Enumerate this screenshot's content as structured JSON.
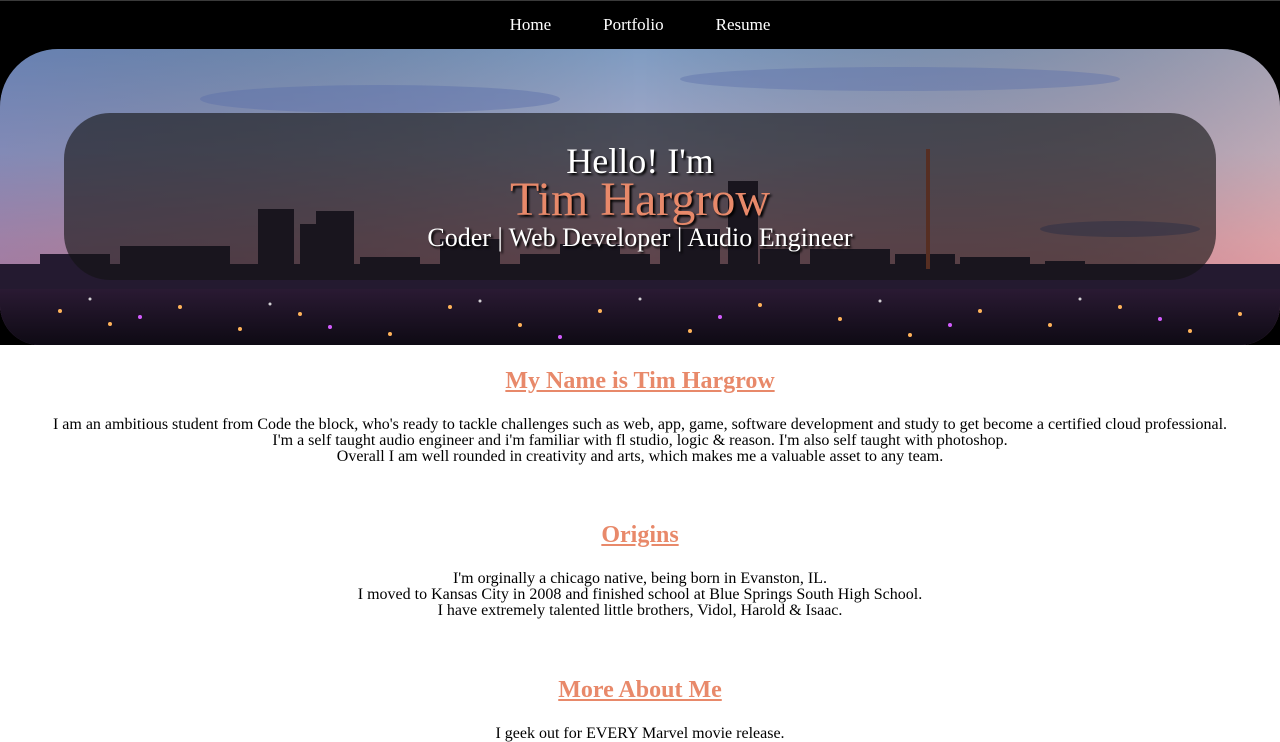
{
  "nav": {
    "items": [
      {
        "label": "Home"
      },
      {
        "label": "Portfolio"
      },
      {
        "label": "Resume"
      }
    ]
  },
  "hero": {
    "greeting": "Hello! I'm",
    "name": "Tim Hargrow",
    "tagline": "Coder | Web Developer | Audio Engineer",
    "image": "city-skyline-at-dusk"
  },
  "sections": [
    {
      "heading": "My Name is Tim Hargrow",
      "lines": [
        "I am an ambitious student from Code the block, who's ready to tackle challenges such as web, app, game, software development and study to get become a certified cloud professional.",
        "I'm a self taught audio engineer and i'm familiar with fl studio, logic & reason. I'm also self taught with photoshop.",
        "Overall I am well rounded in creativity and arts, which makes me a valuable asset to any team."
      ]
    },
    {
      "heading": "Origins",
      "lines": [
        "I'm orginally a chicago native, being born in Evanston, IL.",
        "I moved to Kansas City in 2008 and finished school at Blue Springs South High School.",
        "I have extremely talented little brothers, Vidol, Harold & Isaac."
      ]
    },
    {
      "heading": "More About Me",
      "lines": [
        "I geek out for EVERY Marvel movie release."
      ]
    }
  ],
  "colors": {
    "accent": "#e8896a",
    "nav_bg": "#000000",
    "text": "#000000"
  }
}
